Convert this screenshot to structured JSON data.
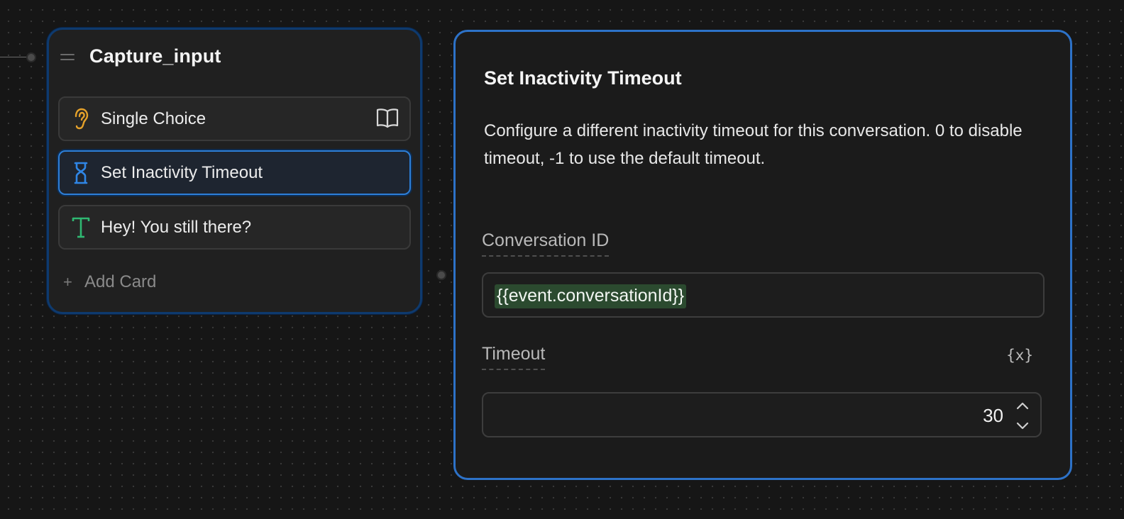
{
  "node": {
    "title": "Capture_input",
    "cards": [
      {
        "label": "Single Choice",
        "icon": "ear-icon",
        "icon_color": "#e5a12a",
        "badge_icon": "book-icon"
      },
      {
        "label": "Set Inactivity Timeout",
        "icon": "hourglass-icon",
        "icon_color": "#2f86e6",
        "selected": true
      },
      {
        "label": "Hey! You still there?",
        "icon": "text-icon",
        "icon_color": "#2fb872"
      }
    ],
    "add_card_label": "Add Card"
  },
  "panel": {
    "title": "Set Inactivity Timeout",
    "description": "Configure a different inactivity timeout for this conversation. 0 to disable timeout, -1 to use the default timeout.",
    "fields": {
      "conversation_id": {
        "label": "Conversation ID",
        "value": "{{event.conversationId}}"
      },
      "timeout": {
        "label": "Timeout",
        "variable_button": "{x}",
        "value": "30"
      }
    }
  },
  "colors": {
    "accent_blue": "#2d72c8",
    "node_border": "#0e3a6e",
    "token_bg": "#2b4a2f"
  }
}
